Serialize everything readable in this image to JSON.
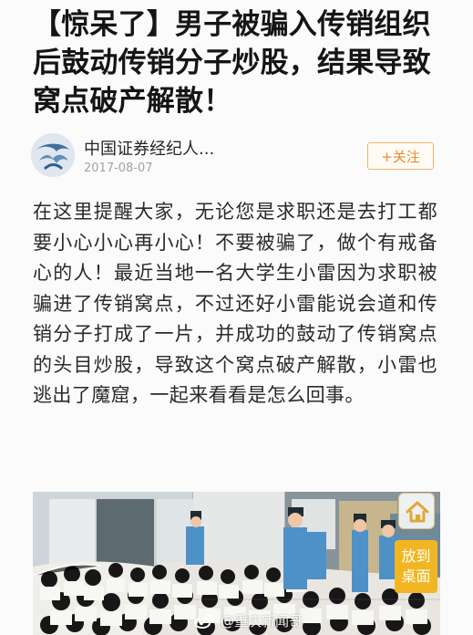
{
  "article": {
    "title": "【惊呆了】男子被骗入传销组织后鼓动传销分子炒股，结果导致窝点破产解散！",
    "author": {
      "name": "中国证券经纪人...",
      "date": "2017-08-07",
      "avatar_icon": "avatar-icon",
      "follow_label": "+关注"
    },
    "body": "在这里提醒大家，无论您是求职还是去打工都要小心小心再小心！不要被骗了，做个有戒备心的人！最近当地一名大学生小雷因为求职被骗进了传销窝点，不过还好小雷能说会道和传销分子打成了一片，并成功的鼓动了传销窝点的头目炒股，导致这个窝点破产解散，小雷也逃出了魔窟，一起来看看是怎么回事。"
  },
  "overlay": {
    "home_icon": "home-icon",
    "desktop_shortcut": "放到\n桌面",
    "watermark_icon": "weibo-logo-icon",
    "watermark_text": "@重庆新闻哥"
  },
  "colors": {
    "title": "#151515",
    "body": "#2a2a2a",
    "date": "#a3a3a3",
    "follow": "#e38d2d",
    "shortcut": "#f2b624"
  }
}
